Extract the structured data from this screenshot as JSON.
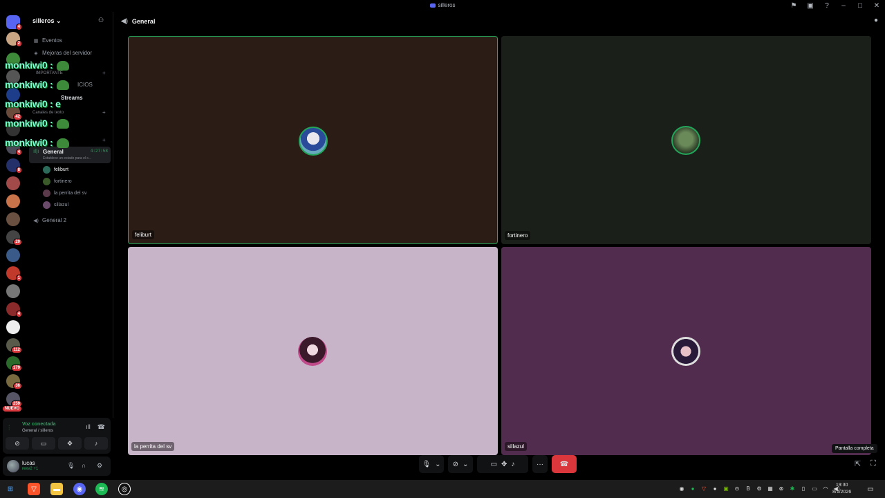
{
  "window": {
    "title": "silleros"
  },
  "server": {
    "name": "silleros"
  },
  "sidebar": {
    "events": "Eventos",
    "boosts": "Mejoras del servidor",
    "cat_important": "IMPORTANTE",
    "ch_announcements": "ICIOS",
    "ch_streams": "Streams",
    "cat_text": "Canales de texto",
    "voice_channel": "General",
    "voice_time": "4:27:58",
    "voice_status": "Establece un estado para el c...",
    "members": [
      "feliburt",
      "fortinero",
      "la perrita del sv",
      "sillazul"
    ],
    "voice_channel_2": "General 2"
  },
  "overlay_messages": [
    {
      "user": "monkiwi0",
      "text": ":"
    },
    {
      "user": "monkiwi0",
      "text": ":"
    },
    {
      "user": "monkiwi0",
      "text": ": e"
    },
    {
      "user": "monkiwi0",
      "text": ":"
    },
    {
      "user": "monkiwi0",
      "text": ":"
    }
  ],
  "rail_badges": [
    "4",
    "2",
    "42",
    "4",
    "8",
    "20",
    "1",
    "4",
    "112",
    "179",
    "36",
    "259"
  ],
  "rail_new": "NUEVO",
  "voice_panel": {
    "title": "Voz conectada",
    "subtitle": "General / silleros"
  },
  "user_panel": {
    "name": "lucas",
    "status": "rexv2 +1"
  },
  "main": {
    "channel": "General",
    "tiles": [
      {
        "name": "feliburt",
        "bg": "#2b1d15",
        "speaking": true
      },
      {
        "name": "fortinero",
        "bg": "#1b1f19",
        "speaking": false
      },
      {
        "name": "la perrita del sv",
        "bg": "#c8b4c9",
        "speaking": false
      },
      {
        "name": "sillazul",
        "bg": "#522c4e",
        "speaking": false
      }
    ],
    "tooltip": "Pantalla completa"
  },
  "taskbar": {
    "time": "19:30",
    "date": "8/1/2026"
  },
  "colors": {
    "accent": "#5865f2",
    "green": "#23a55a",
    "danger": "#da373c"
  }
}
